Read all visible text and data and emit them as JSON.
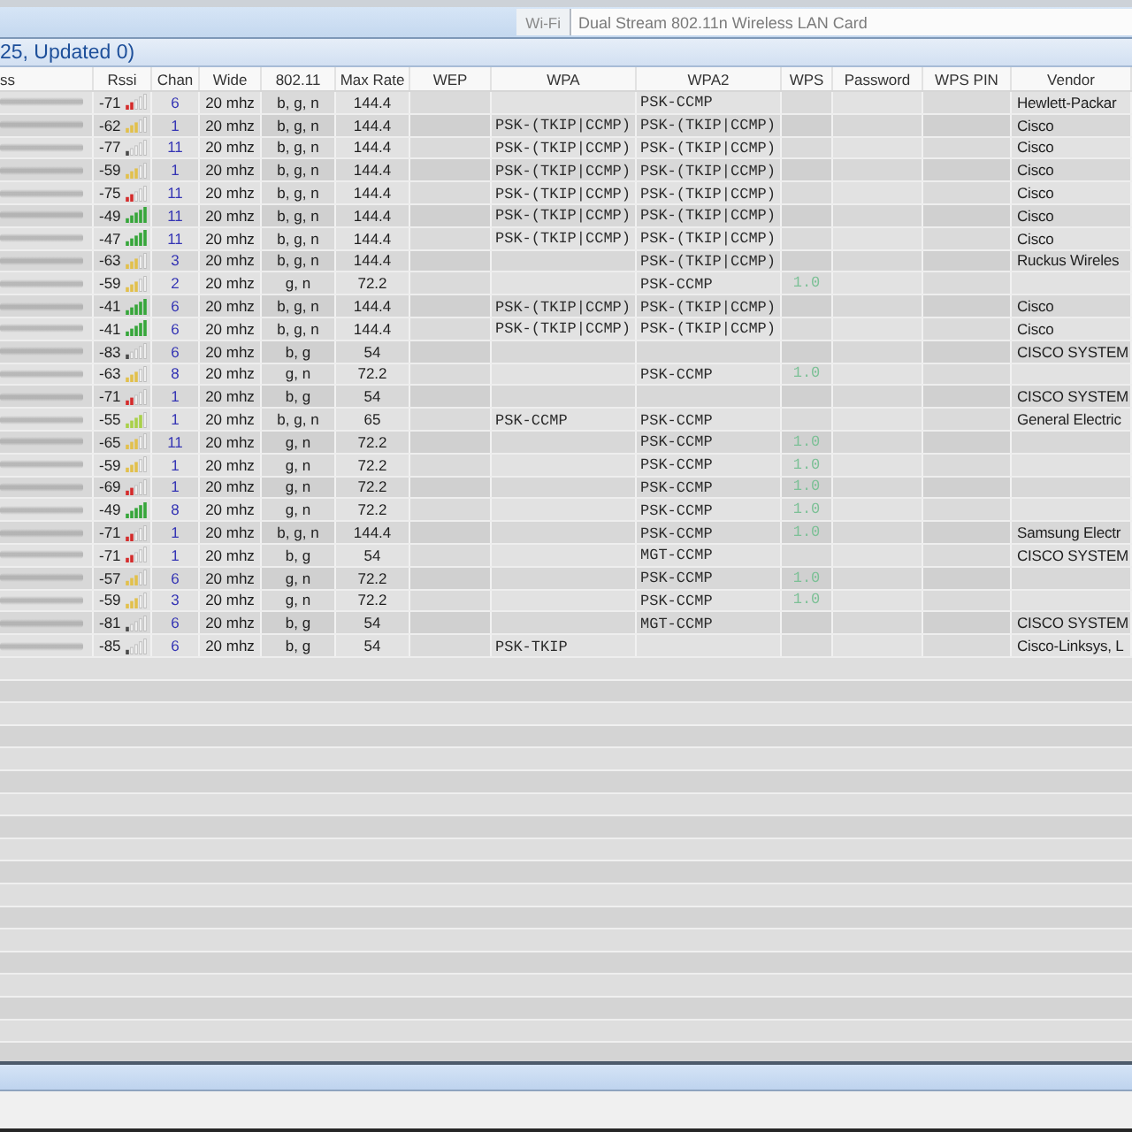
{
  "toolbar": {
    "adapter_type": "Wi-Fi",
    "adapter": "Dual Stream 802.11n Wireless LAN Card"
  },
  "group_header": "25, Updated 0)",
  "table": {
    "columns": [
      "ss",
      "Rssi",
      "Chan",
      "Wide",
      "802.11",
      "Max Rate",
      "WEP",
      "WPA",
      "WPA2",
      "WPS",
      "Password",
      "WPS PIN",
      "Vendor"
    ],
    "rows": [
      {
        "kind": "low",
        "rssi": "-71",
        "chan": "6",
        "wide": "20 mhz",
        "mode": "b, g, n",
        "max_rate": "144.4",
        "wpa2": "PSK-CCMP",
        "vendor": "Hewlett-Packar"
      },
      {
        "kind": "medium",
        "rssi": "-62",
        "chan": "1",
        "wide": "20 mhz",
        "mode": "b, g, n",
        "max_rate": "144.4",
        "wpa": "PSK-(TKIP|CCMP)",
        "wpa2": "PSK-(TKIP|CCMP)",
        "vendor": "Cisco"
      },
      {
        "kind": "none",
        "rssi": "-77",
        "chan": "11",
        "wide": "20 mhz",
        "mode": "b, g, n",
        "max_rate": "144.4",
        "wpa": "PSK-(TKIP|CCMP)",
        "wpa2": "PSK-(TKIP|CCMP)",
        "vendor": "Cisco"
      },
      {
        "kind": "medium",
        "rssi": "-59",
        "chan": "1",
        "wide": "20 mhz",
        "mode": "b, g, n",
        "max_rate": "144.4",
        "wpa": "PSK-(TKIP|CCMP)",
        "wpa2": "PSK-(TKIP|CCMP)",
        "vendor": "Cisco"
      },
      {
        "kind": "low",
        "rssi": "-75",
        "chan": "11",
        "wide": "20 mhz",
        "mode": "b, g, n",
        "max_rate": "144.4",
        "wpa": "PSK-(TKIP|CCMP)",
        "wpa2": "PSK-(TKIP|CCMP)",
        "vendor": "Cisco"
      },
      {
        "kind": "high",
        "rssi": "-49",
        "chan": "11",
        "wide": "20 mhz",
        "mode": "b, g, n",
        "max_rate": "144.4",
        "wpa": "PSK-(TKIP|CCMP)",
        "wpa2": "PSK-(TKIP|CCMP)",
        "vendor": "Cisco"
      },
      {
        "kind": "high",
        "rssi": "-47",
        "chan": "11",
        "wide": "20 mhz",
        "mode": "b, g, n",
        "max_rate": "144.4",
        "wpa": "PSK-(TKIP|CCMP)",
        "wpa2": "PSK-(TKIP|CCMP)",
        "vendor": "Cisco"
      },
      {
        "kind": "medium",
        "rssi": "-63",
        "chan": "3",
        "wide": "20 mhz",
        "mode": "b, g, n",
        "max_rate": "144.4",
        "wpa2": "PSK-(TKIP|CCMP)",
        "vendor": "Ruckus Wireles"
      },
      {
        "kind": "medium",
        "rssi": "-59",
        "chan": "2",
        "wide": "20 mhz",
        "mode": "g, n",
        "max_rate": "72.2",
        "wpa2": "PSK-CCMP",
        "wps": "1.0"
      },
      {
        "kind": "high",
        "rssi": "-41",
        "chan": "6",
        "wide": "20 mhz",
        "mode": "b, g, n",
        "max_rate": "144.4",
        "wpa": "PSK-(TKIP|CCMP)",
        "wpa2": "PSK-(TKIP|CCMP)",
        "vendor": "Cisco"
      },
      {
        "kind": "high",
        "rssi": "-41",
        "chan": "6",
        "wide": "20 mhz",
        "mode": "b, g, n",
        "max_rate": "144.4",
        "wpa": "PSK-(TKIP|CCMP)",
        "wpa2": "PSK-(TKIP|CCMP)",
        "vendor": "Cisco"
      },
      {
        "kind": "none",
        "rssi": "-83",
        "chan": "6",
        "wide": "20 mhz",
        "mode": "b, g",
        "max_rate": "54",
        "vendor": "CISCO SYSTEM"
      },
      {
        "kind": "medium",
        "rssi": "-63",
        "chan": "8",
        "wide": "20 mhz",
        "mode": "g, n",
        "max_rate": "72.2",
        "wpa2": "PSK-CCMP",
        "wps": "1.0"
      },
      {
        "kind": "low",
        "rssi": "-71",
        "chan": "1",
        "wide": "20 mhz",
        "mode": "b, g",
        "max_rate": "54",
        "vendor": "CISCO SYSTEM"
      },
      {
        "kind": "good",
        "rssi": "-55",
        "chan": "1",
        "wide": "20 mhz",
        "mode": "b, g, n",
        "max_rate": "65",
        "wpa": "PSK-CCMP",
        "wpa2": "PSK-CCMP",
        "vendor": "General Electric"
      },
      {
        "kind": "medium",
        "rssi": "-65",
        "chan": "11",
        "wide": "20 mhz",
        "mode": "g, n",
        "max_rate": "72.2",
        "wpa2": "PSK-CCMP",
        "wps": "1.0"
      },
      {
        "kind": "medium",
        "rssi": "-59",
        "chan": "1",
        "wide": "20 mhz",
        "mode": "g, n",
        "max_rate": "72.2",
        "wpa2": "PSK-CCMP",
        "wps": "1.0"
      },
      {
        "kind": "low",
        "rssi": "-69",
        "chan": "1",
        "wide": "20 mhz",
        "mode": "g, n",
        "max_rate": "72.2",
        "wpa2": "PSK-CCMP",
        "wps": "1.0"
      },
      {
        "kind": "high",
        "rssi": "-49",
        "chan": "8",
        "wide": "20 mhz",
        "mode": "g, n",
        "max_rate": "72.2",
        "wpa2": "PSK-CCMP",
        "wps": "1.0"
      },
      {
        "kind": "low",
        "rssi": "-71",
        "chan": "1",
        "wide": "20 mhz",
        "mode": "b, g, n",
        "max_rate": "144.4",
        "wpa2": "PSK-CCMP",
        "wps": "1.0",
        "vendor": "Samsung Electr"
      },
      {
        "kind": "low",
        "rssi": "-71",
        "chan": "1",
        "wide": "20 mhz",
        "mode": "b, g",
        "max_rate": "54",
        "wpa2": "MGT-CCMP",
        "vendor": "CISCO SYSTEM"
      },
      {
        "kind": "medium",
        "rssi": "-57",
        "chan": "6",
        "wide": "20 mhz",
        "mode": "g, n",
        "max_rate": "72.2",
        "wpa2": "PSK-CCMP",
        "wps": "1.0"
      },
      {
        "kind": "medium",
        "rssi": "-59",
        "chan": "3",
        "wide": "20 mhz",
        "mode": "g, n",
        "max_rate": "72.2",
        "wpa2": "PSK-CCMP",
        "wps": "1.0"
      },
      {
        "kind": "none",
        "rssi": "-81",
        "chan": "6",
        "wide": "20 mhz",
        "mode": "b, g",
        "max_rate": "54",
        "wpa2": "MGT-CCMP",
        "vendor": "CISCO SYSTEM"
      },
      {
        "kind": "none",
        "rssi": "-85",
        "chan": "6",
        "wide": "20 mhz",
        "mode": "b, g",
        "max_rate": "54",
        "wpa": "PSK-TKIP",
        "vendor": "Cisco-Linksys, L"
      }
    ]
  }
}
